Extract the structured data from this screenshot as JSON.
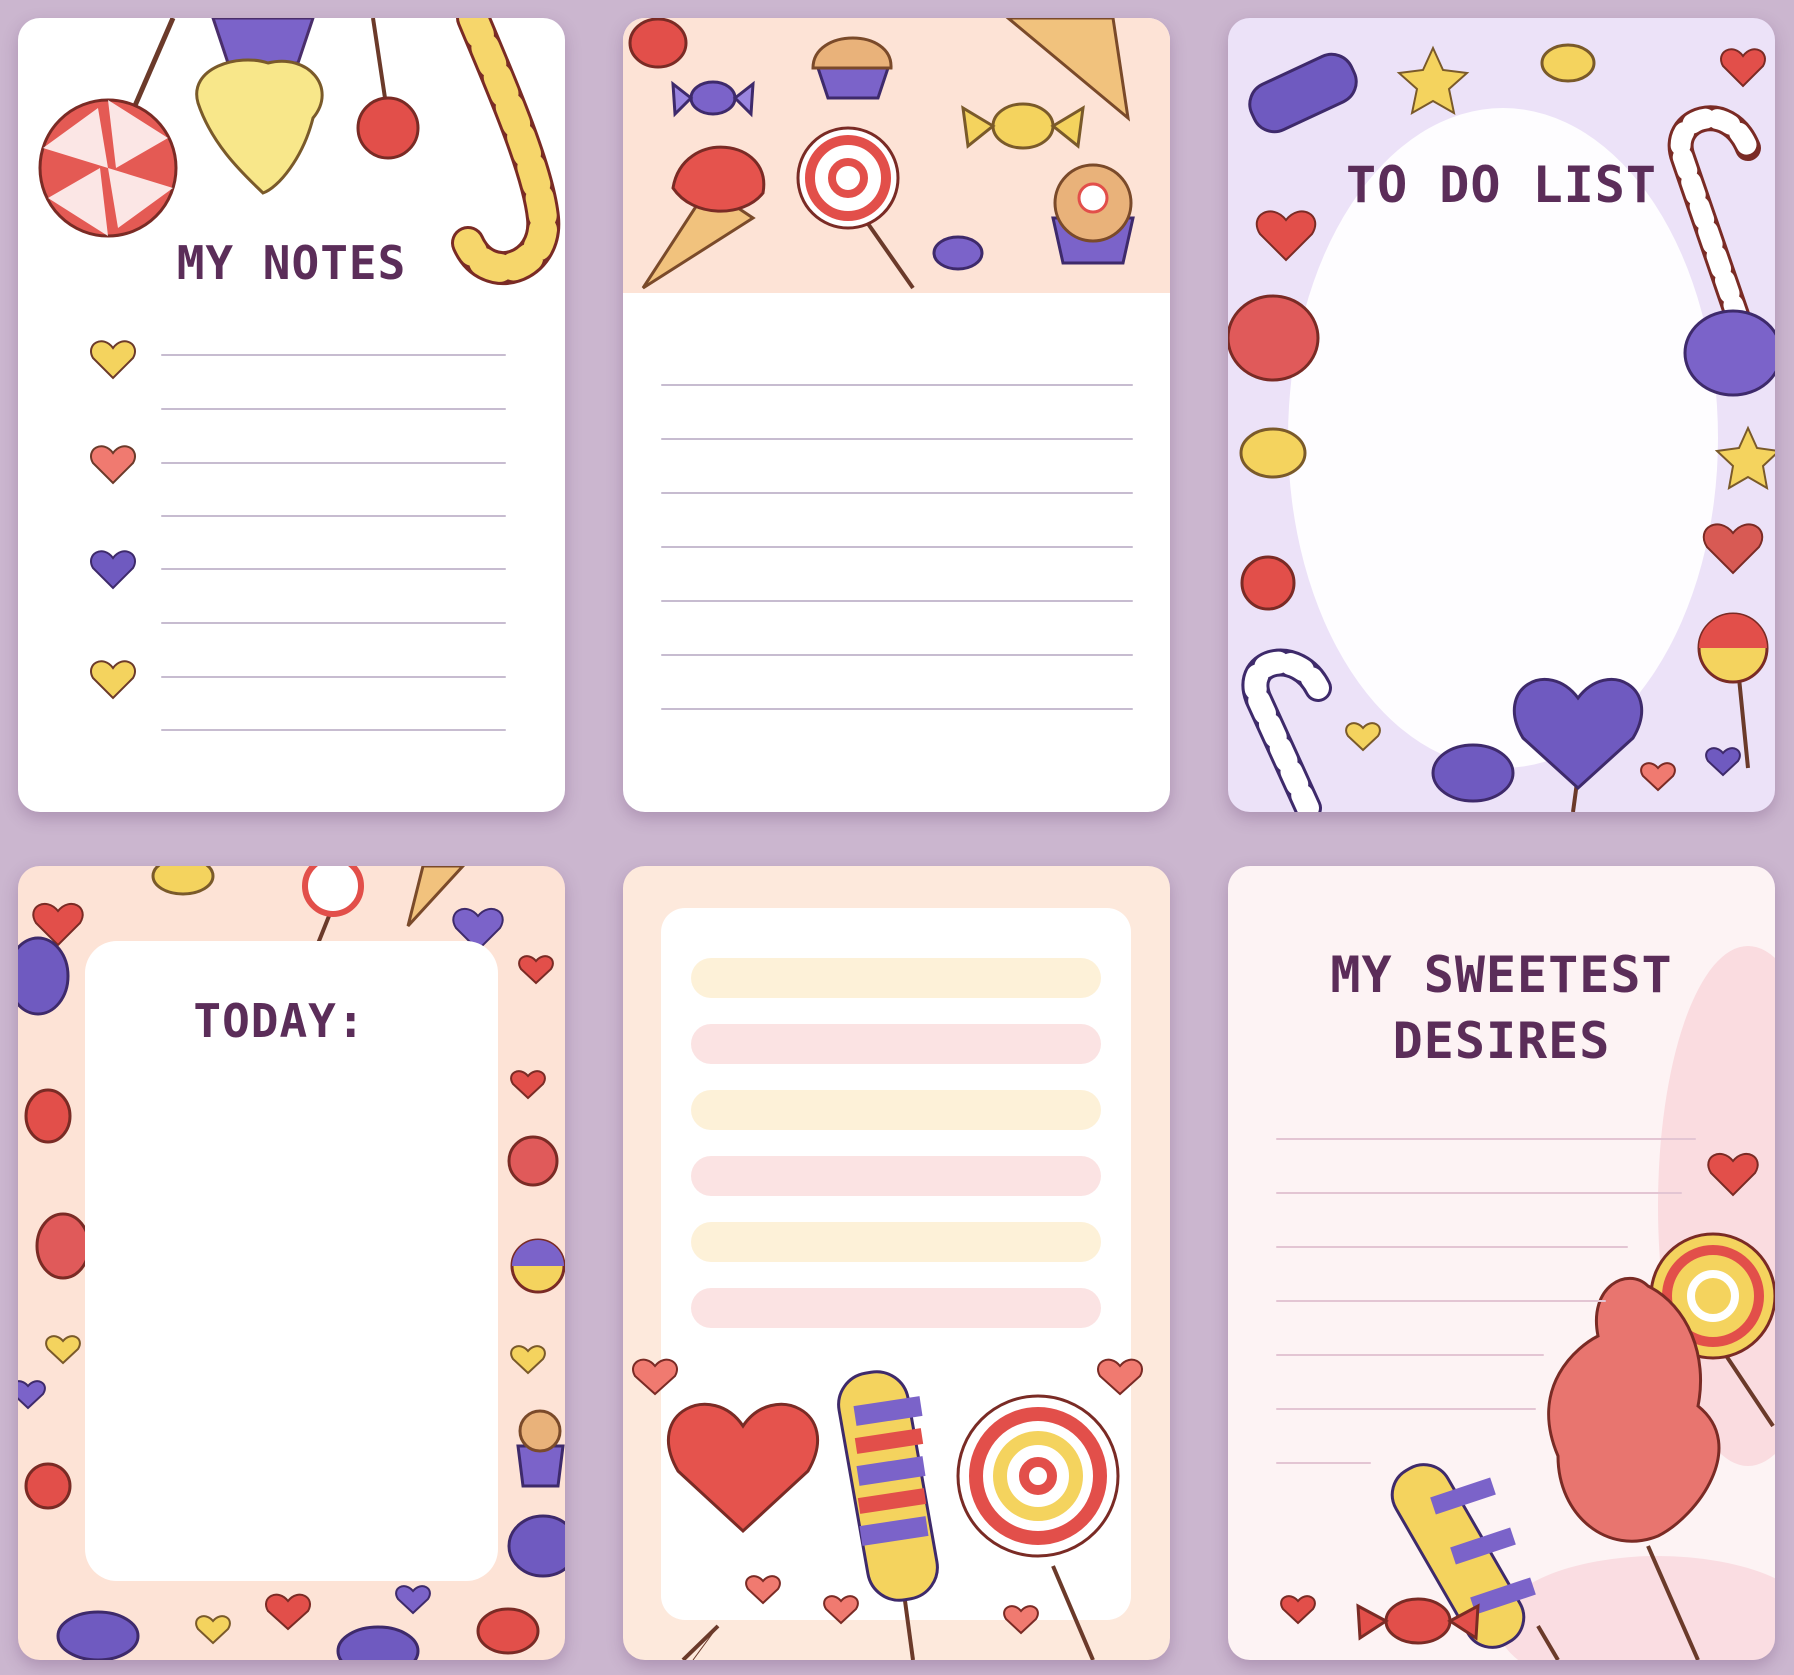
{
  "cards": [
    {
      "title": "MY NOTES"
    },
    {
      "title": ""
    },
    {
      "title": "TO DO LIST"
    },
    {
      "title": "TODAY:"
    },
    {
      "title": ""
    },
    {
      "title_line1": "MY SWEETEST",
      "title_line2": "DESIRES"
    }
  ],
  "colors": {
    "background": "#cbb6cf",
    "title": "#5b2d59",
    "red": "#e05a5a",
    "yellow": "#f4dc6a",
    "purple": "#7b63c9",
    "peach": "#fde9dc",
    "lavender": "#ebdff7"
  }
}
